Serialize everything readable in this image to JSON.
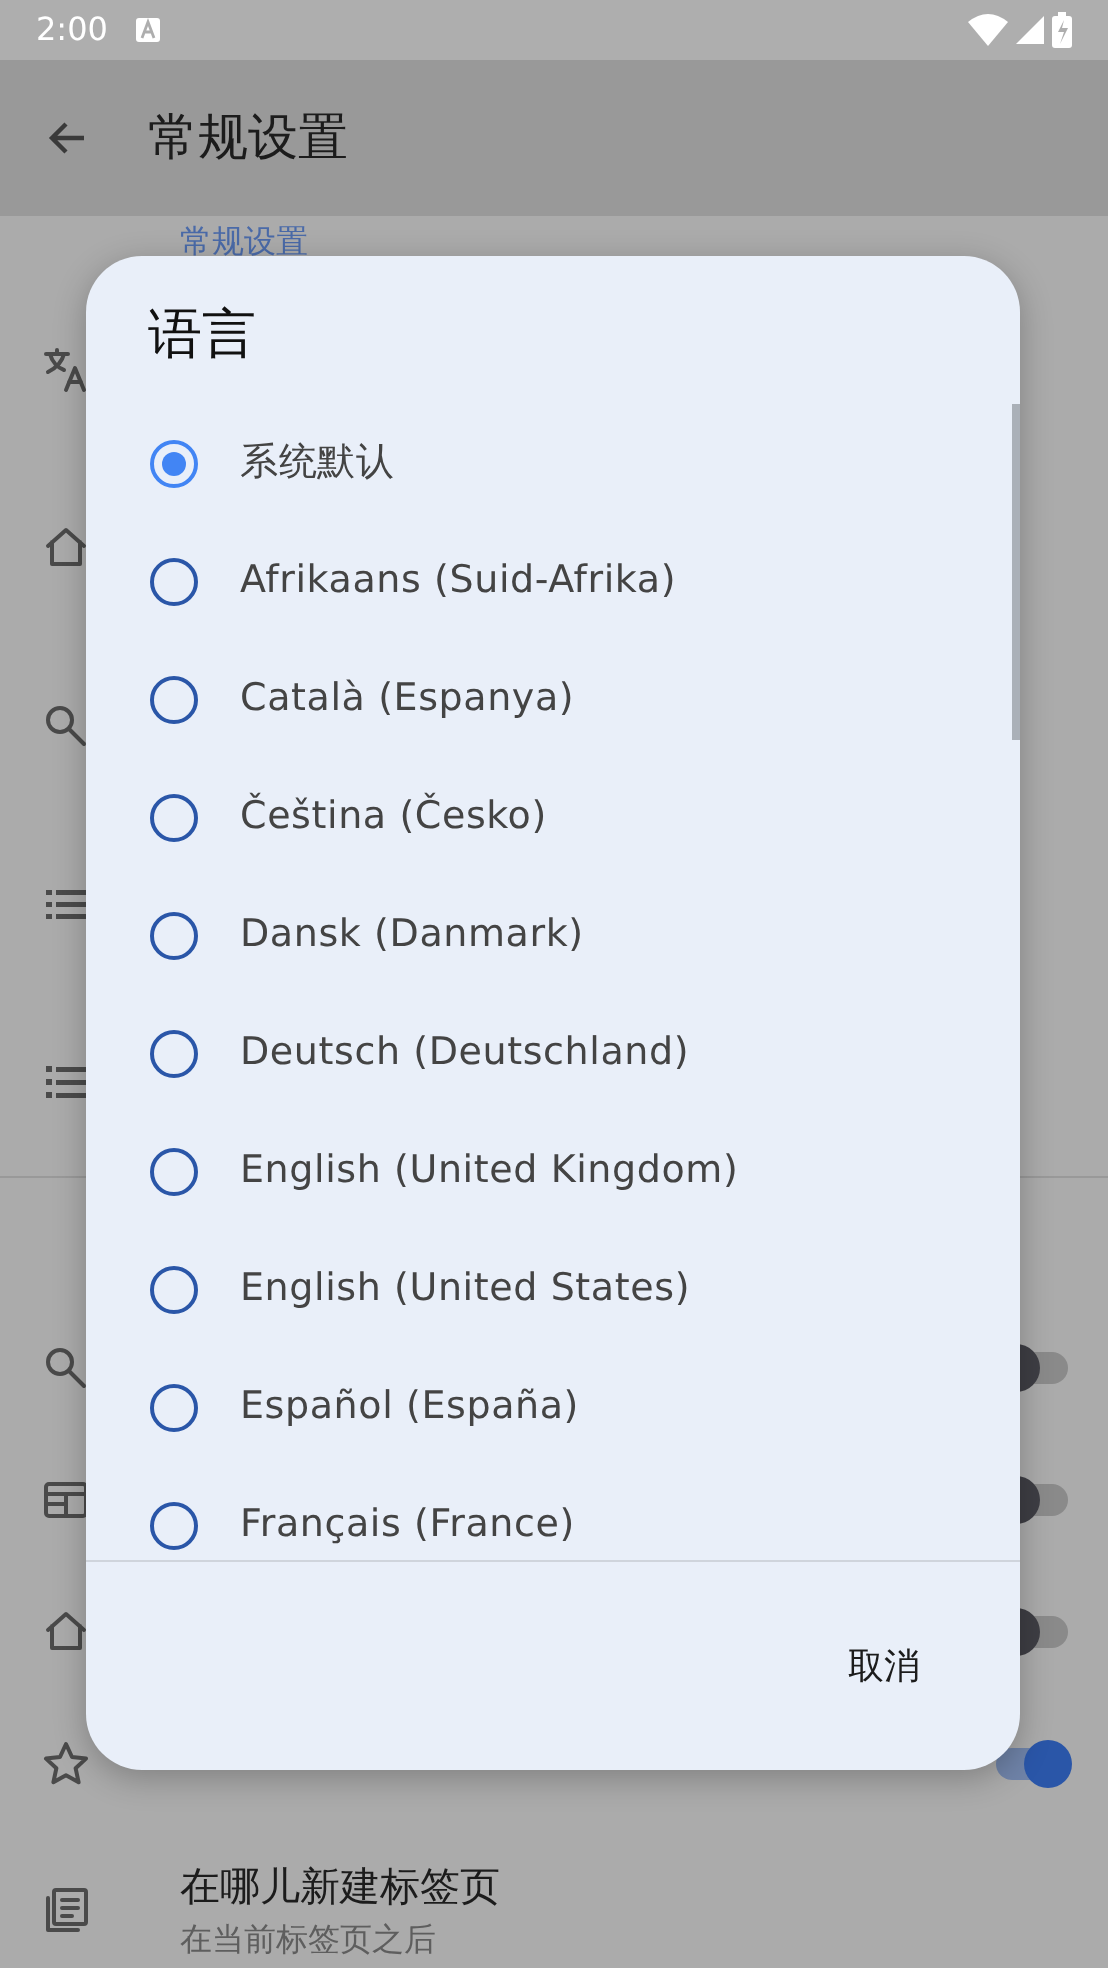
{
  "status_bar": {
    "time": "2:00"
  },
  "app_bar": {
    "title": "常规设置"
  },
  "section_header": "常规设置",
  "settings": [
    {
      "kind": "translate"
    },
    {
      "kind": "home"
    },
    {
      "kind": "search"
    },
    {
      "kind": "list"
    },
    {
      "kind": "numbered-list"
    },
    {
      "kind": "search",
      "on": false
    },
    {
      "kind": "layout",
      "on": false
    },
    {
      "kind": "home",
      "on": false
    },
    {
      "kind": "star",
      "on": true
    },
    {
      "kind": "newspaper",
      "title": "在哪儿新建标签页",
      "subtitle": "在当前标签页之后"
    }
  ],
  "dialog": {
    "title": "语言",
    "options": [
      {
        "label": "系统默认",
        "selected": true
      },
      {
        "label": "Afrikaans (Suid-Afrika)",
        "selected": false
      },
      {
        "label": "Català (Espanya)",
        "selected": false
      },
      {
        "label": "Čeština (Česko)",
        "selected": false
      },
      {
        "label": "Dansk (Danmark)",
        "selected": false
      },
      {
        "label": "Deutsch (Deutschland)",
        "selected": false
      },
      {
        "label": "English (United Kingdom)",
        "selected": false
      },
      {
        "label": "English (United States)",
        "selected": false
      },
      {
        "label": "Español (España)",
        "selected": false
      },
      {
        "label": "Français (France)",
        "selected": false
      }
    ],
    "cancel": "取消"
  }
}
